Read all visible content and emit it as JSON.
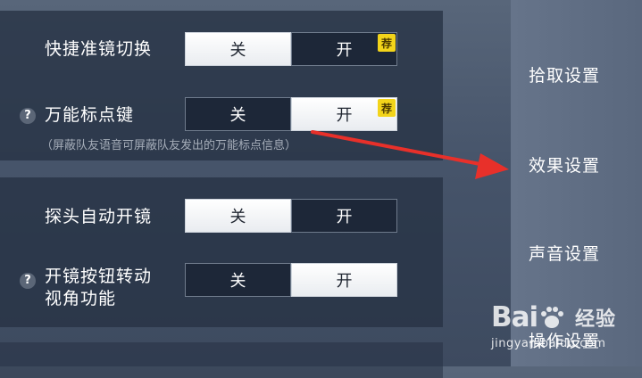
{
  "settings": [
    {
      "label": "快捷准镜切换",
      "has_help": false,
      "off_label": "关",
      "on_label": "开",
      "selected": "off",
      "badge": "荐",
      "note": ""
    },
    {
      "label": "万能标点键",
      "has_help": true,
      "off_label": "关",
      "on_label": "开",
      "selected": "on",
      "badge": "荐",
      "note": "（屏蔽队友语音可屏蔽队友发出的万能标点信息）"
    },
    {
      "label": "探头自动开镜",
      "has_help": false,
      "off_label": "关",
      "on_label": "开",
      "selected": "off",
      "badge": "",
      "note": ""
    },
    {
      "label_line1": "开镜按钮转动",
      "label_line2": "视角功能",
      "has_help": true,
      "off_label": "关",
      "on_label": "开",
      "selected": "on",
      "badge": "",
      "note": ""
    }
  ],
  "help_glyph": "?",
  "sidebar": {
    "items": [
      {
        "label": "拾取设置"
      },
      {
        "label": "效果设置"
      },
      {
        "label": "声音设置"
      },
      {
        "label": "操作设置"
      }
    ],
    "active_index": 1
  },
  "watermark": {
    "logo": "Bai",
    "brand": "经验",
    "url": "jingyan.baidu.com"
  },
  "colors": {
    "background": "#4c5a6f",
    "panel": "#263244",
    "toggle_on": "#ffffff",
    "toggle_off": "#1c2636",
    "badge": "#f3d41a",
    "arrow": "#e8302a"
  }
}
